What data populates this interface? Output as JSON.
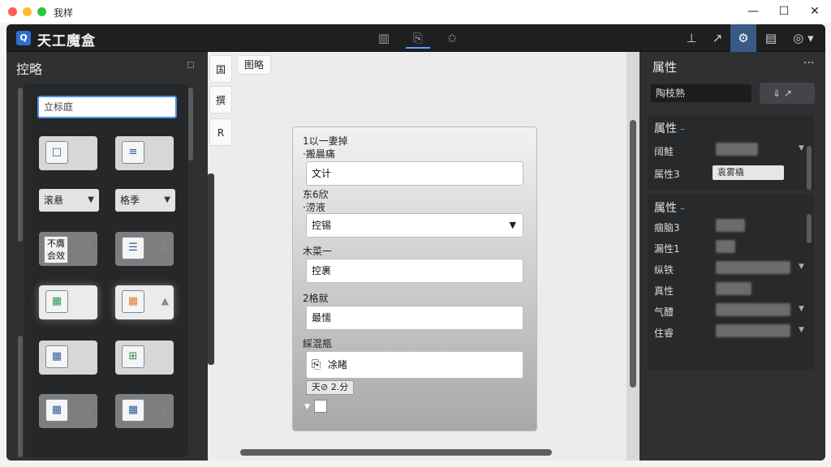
{
  "os": {
    "title": "我样",
    "minimize": "—",
    "maximize": "☐",
    "close": "✕"
  },
  "app": {
    "logo": "Q",
    "title": "天工魔盒",
    "header_icons": [
      "▥",
      "⎘",
      "✩"
    ],
    "right_icons": [
      "⊥",
      "↗",
      "⚙",
      "▤",
      "◎ ▾"
    ]
  },
  "left_panel": {
    "title": "控略",
    "collapse": "◻",
    "search_placeholder": "立标庭",
    "select_a": "滚悬",
    "select_b": "格季",
    "tile_text": "不膺\n会效",
    "tiles_icons": [
      "□",
      "≡",
      "☰",
      "▦",
      "▦",
      "▦",
      "⊞",
      "▦",
      "▦",
      "▦"
    ]
  },
  "canvas": {
    "tab_1": "国",
    "tab_2": "撰",
    "tab_3": "R",
    "label": "图略",
    "form": {
      "label_1": "1以一妻掉",
      "label_1b": "·搬晨痛",
      "input_1": "文计",
      "label_2": "东6欣",
      "label_2b": "·涝液",
      "input_2": "控锡",
      "label_3": "木菜一",
      "input_3": "控裹",
      "label_4": "2格就",
      "input_4": "最懦",
      "label_5": "綵混瓶",
      "input_5": "凃睹",
      "note": "天⊘ 2.分"
    }
  },
  "right_panel": {
    "title": "属性",
    "more": "···",
    "search_value": "陶枝熟",
    "btns": "⇓   ↗",
    "section1_title": "属性",
    "row1_label": "阔鮭",
    "row2_label": "属性3",
    "row2_value": "袁雾橇",
    "section2_title": "属性",
    "rows": [
      "痼脑3",
      "漏性1",
      "纵铁",
      "真性",
      "气醴",
      "住睿"
    ]
  },
  "colors": {
    "accent": "#4a8fe8",
    "panel": "#2f3032",
    "header": "#1e1f21"
  }
}
